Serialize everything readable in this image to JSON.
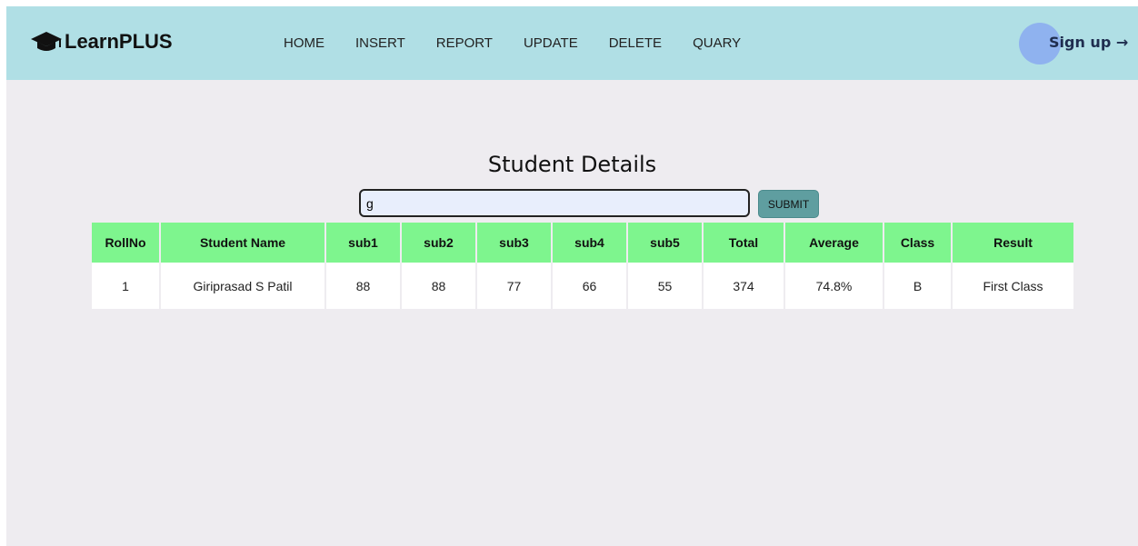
{
  "brand": {
    "name": "LearnPLUS",
    "icon": "graduation-cap-icon"
  },
  "nav": {
    "items": [
      "HOME",
      "INSERT",
      "REPORT",
      "UPDATE",
      "DELETE",
      "QUARY"
    ],
    "signup_label": "Sign up →"
  },
  "page": {
    "title": "Student Details"
  },
  "search": {
    "value": "g",
    "submit_label": "SUBMIT"
  },
  "table": {
    "headers": [
      "RollNo",
      "Student Name",
      "sub1",
      "sub2",
      "sub3",
      "sub4",
      "sub5",
      "Total",
      "Average",
      "Class",
      "Result"
    ],
    "rows": [
      [
        "1",
        "Giriprasad S Patil",
        "88",
        "88",
        "77",
        "66",
        "55",
        "374",
        "74.8%",
        "B",
        "First Class"
      ]
    ]
  },
  "colors": {
    "navbar": "#b0dfe5",
    "table_header": "#7ef58e",
    "submit": "#5f9ea0",
    "background": "#eeecf0"
  }
}
